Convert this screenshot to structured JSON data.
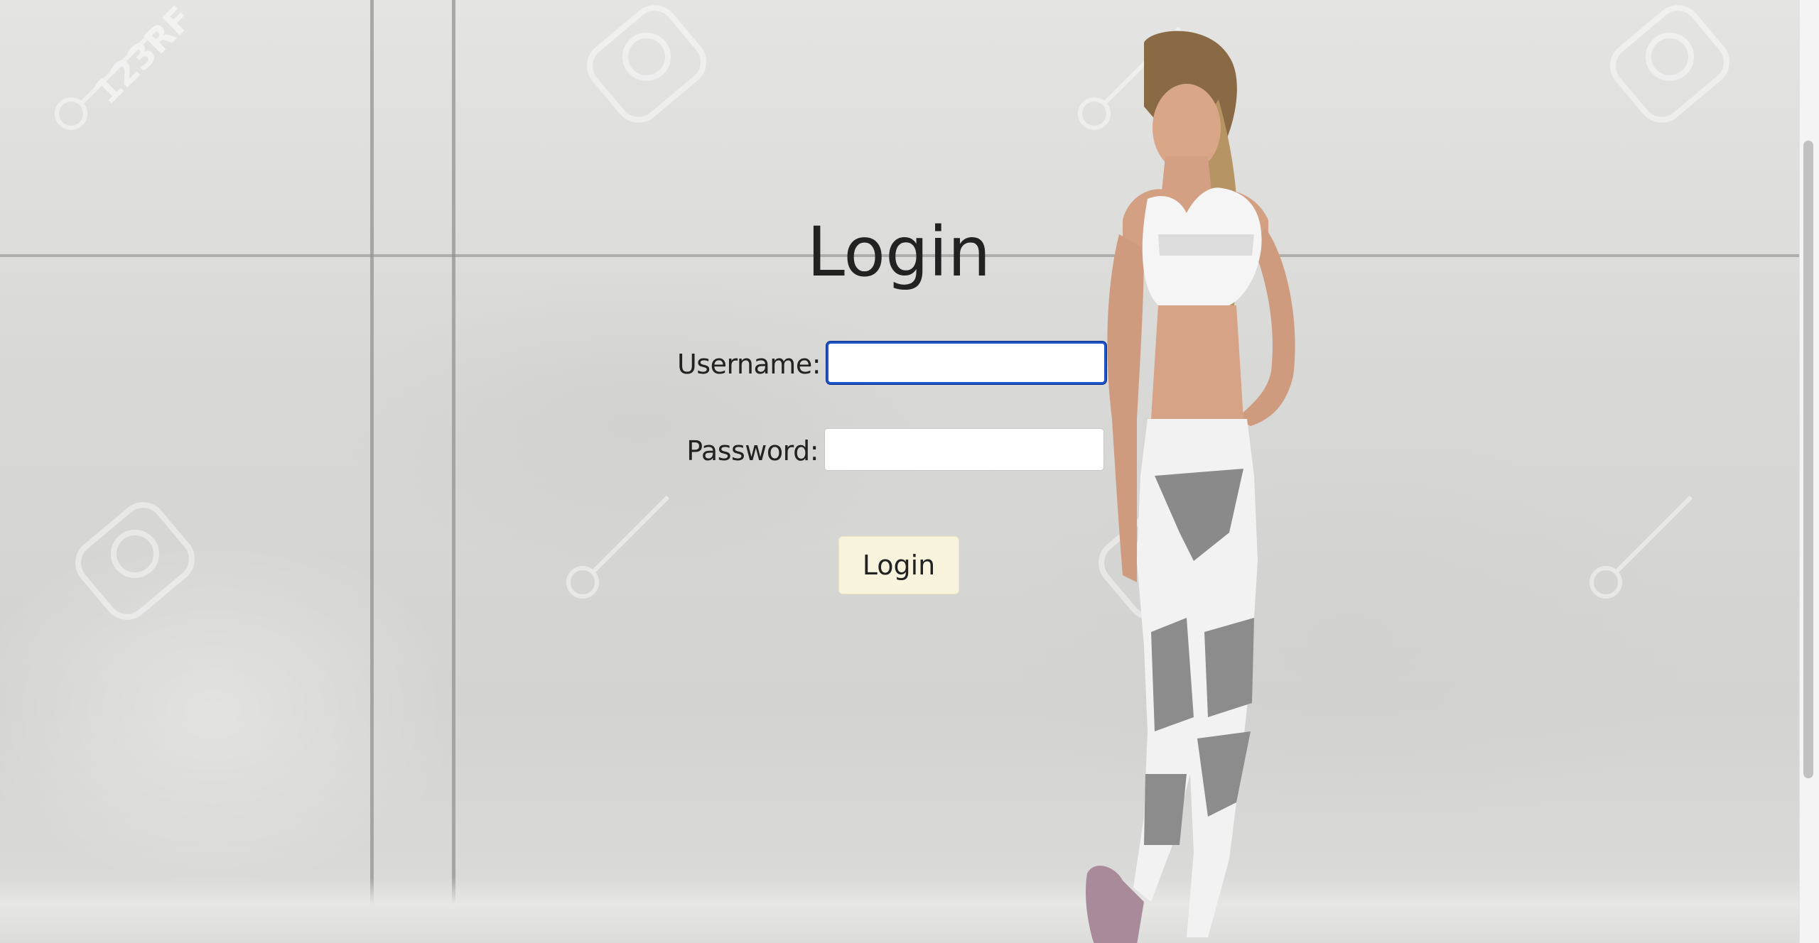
{
  "page": {
    "title": "Login"
  },
  "form": {
    "username_label": "Username:",
    "username_value": "",
    "password_label": "Password:",
    "password_value": "",
    "submit_label": "Login"
  },
  "colors": {
    "focus_ring": "#1f54c7",
    "button_bg": "#f8f3dc",
    "text": "#222222"
  },
  "background": {
    "image": "fitness-woman-against-concrete-wall",
    "watermark_text": "123RF"
  }
}
